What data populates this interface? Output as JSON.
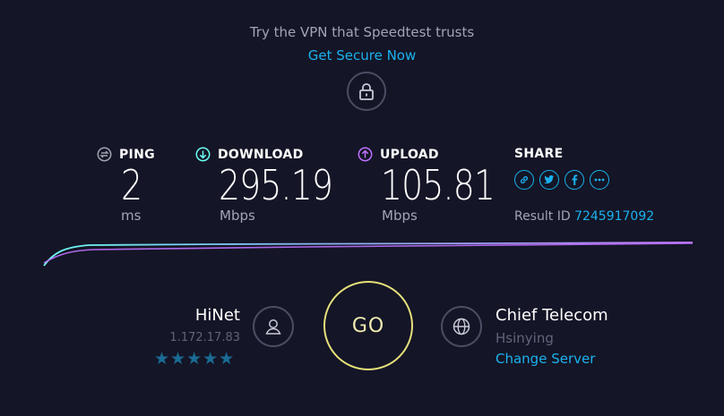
{
  "promo": {
    "text": "Try the VPN that Speedtest trusts",
    "link": "Get Secure Now"
  },
  "stats": {
    "ping": {
      "label": "PING",
      "value": "2",
      "unit": "ms",
      "icon": "ping-icon"
    },
    "download": {
      "label": "DOWNLOAD",
      "value": "295.19",
      "unit": "Mbps",
      "icon": "download-arrow-icon"
    },
    "upload": {
      "label": "UPLOAD",
      "value": "105.81",
      "unit": "Mbps",
      "icon": "upload-arrow-icon"
    }
  },
  "share": {
    "label": "SHARE",
    "icons": [
      "link-icon",
      "twitter-icon",
      "facebook-icon",
      "more-icon"
    ],
    "result_label": "Result ID",
    "result_id": "7245917092"
  },
  "isp": {
    "name": "HiNet",
    "ip": "1.172.17.83",
    "rating": 5,
    "stars": "★★★★★"
  },
  "go": {
    "label": "GO"
  },
  "server": {
    "name": "Chief Telecom",
    "location": "Hsinying",
    "change_label": "Change Server"
  },
  "colors": {
    "background": "#141526",
    "accent_blue": "#1ab2ef",
    "download_line": "#6afff3",
    "upload_line": "#bf71ff",
    "go_ring": "#e6e07a"
  }
}
